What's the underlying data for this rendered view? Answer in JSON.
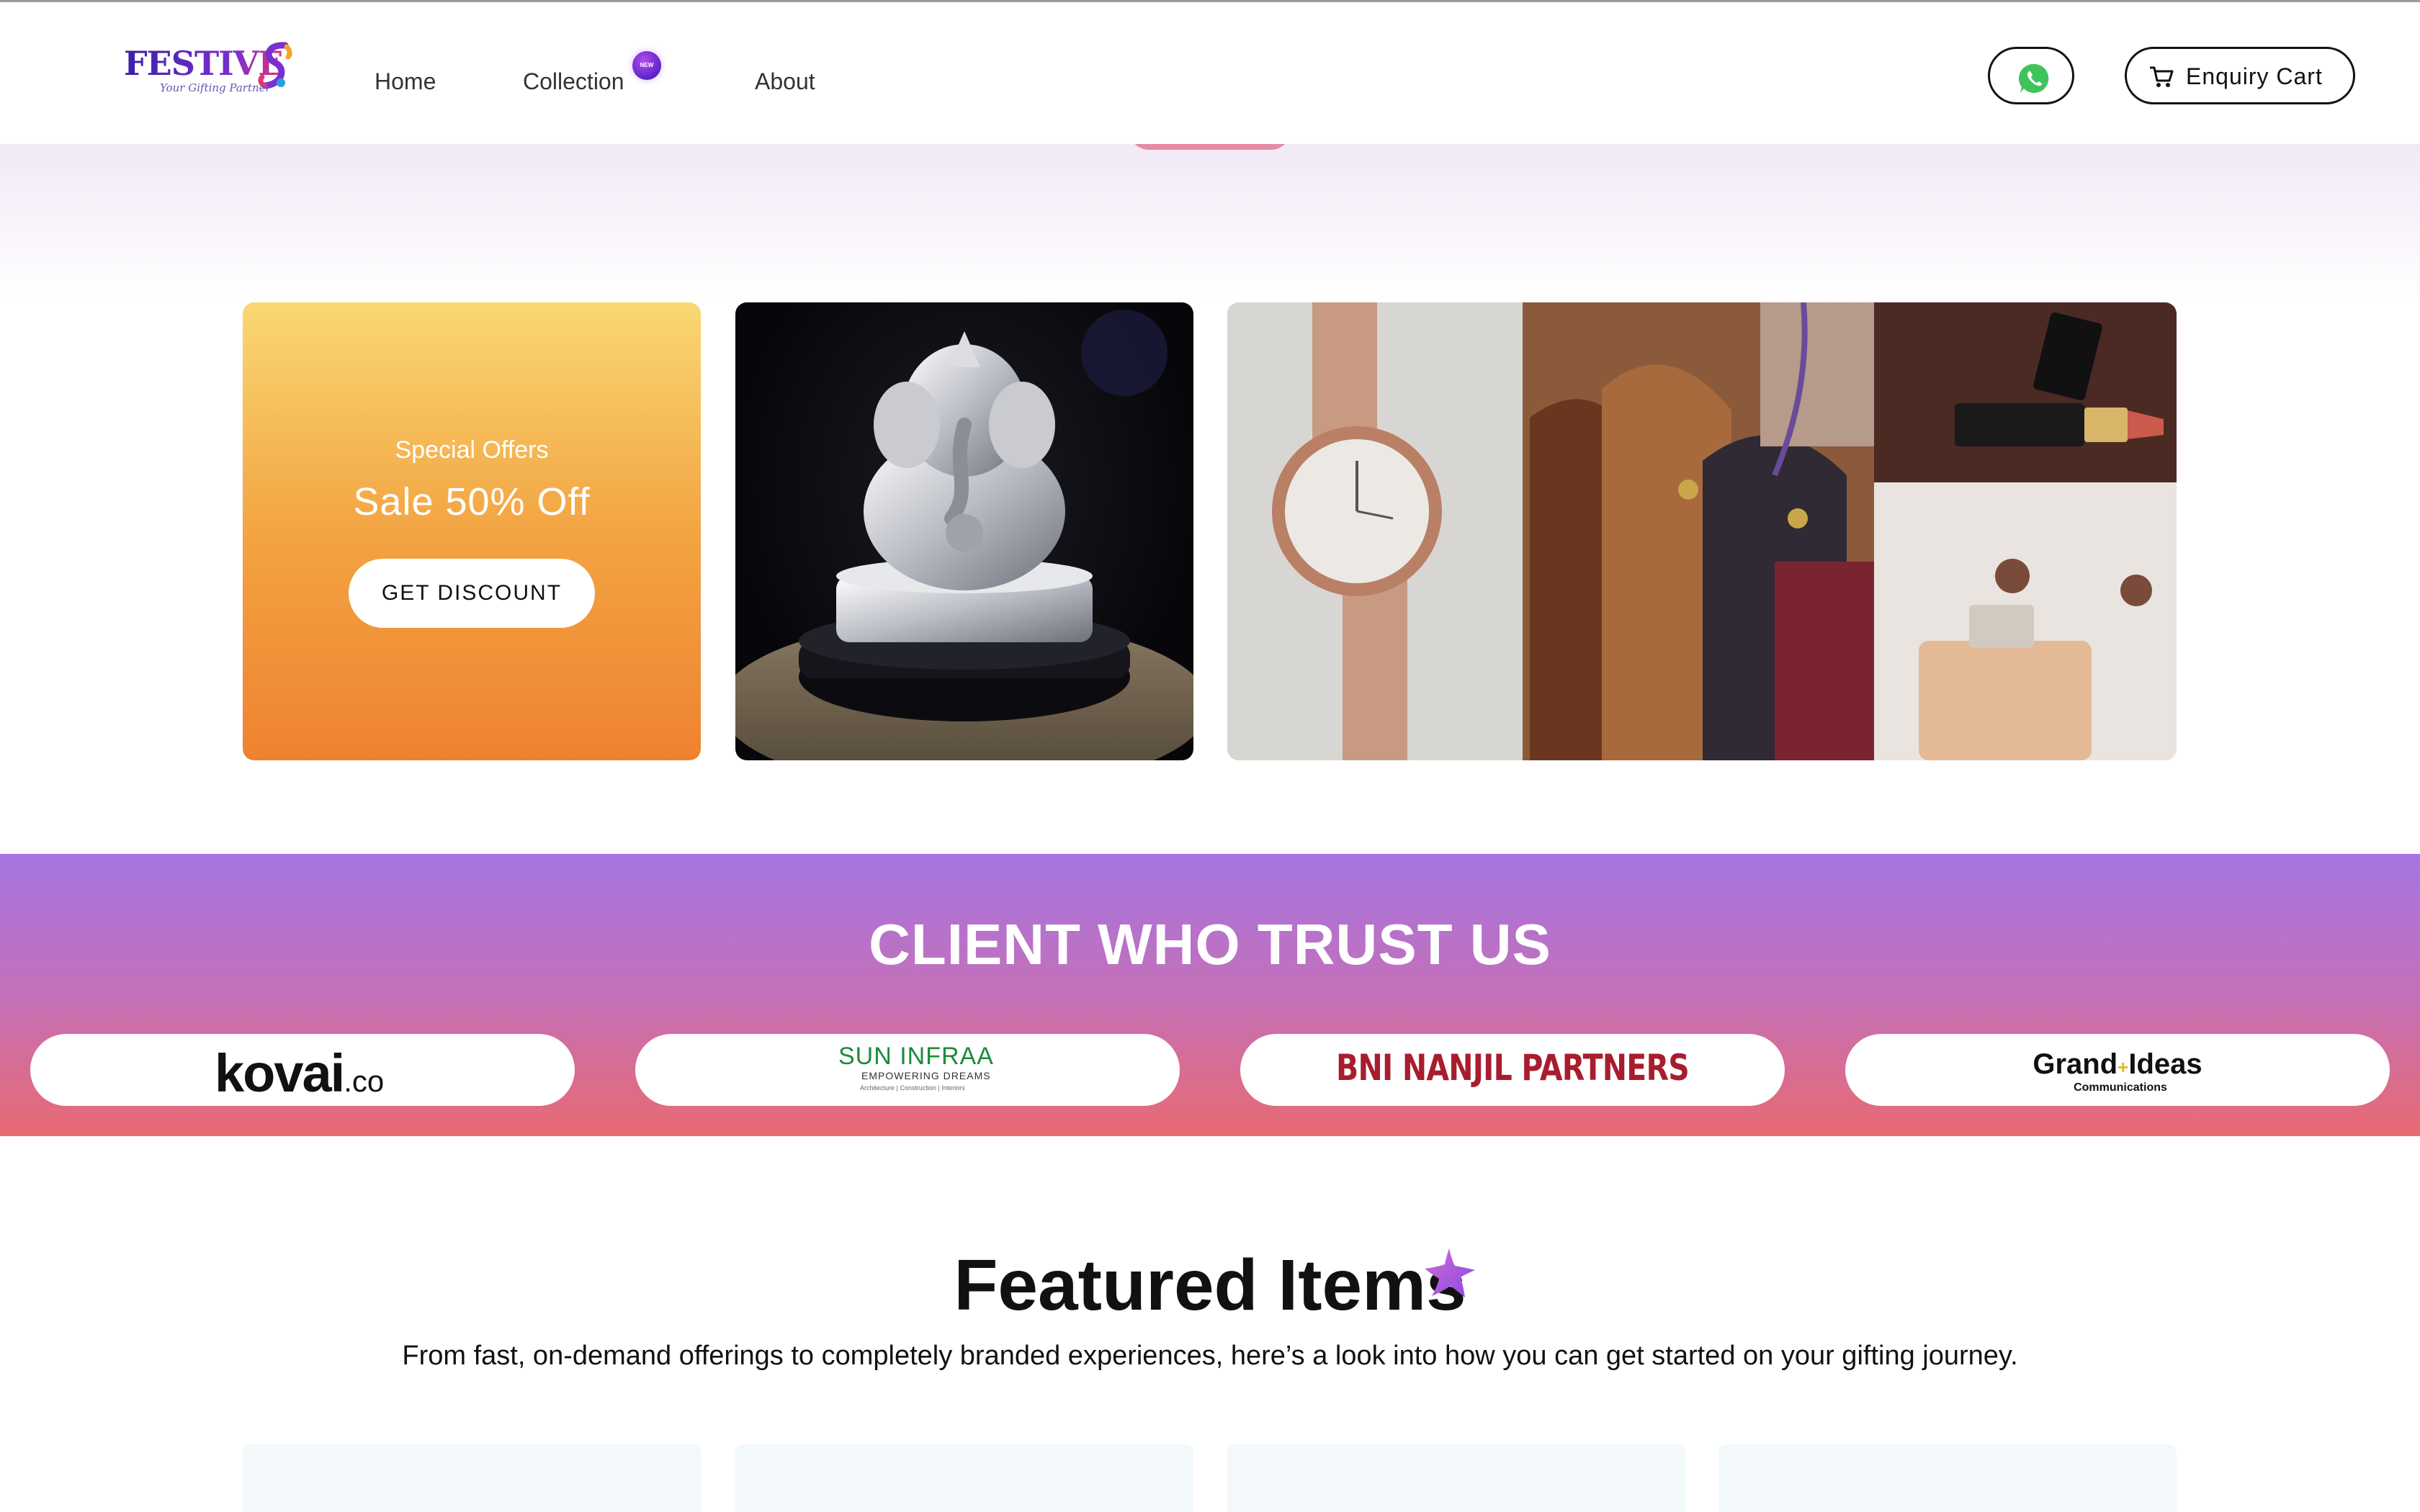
{
  "brand": {
    "name": "FESTIVE",
    "tagline": "Your Gifting Partner"
  },
  "nav": {
    "home": "Home",
    "collection": "Collection",
    "collection_badge": "NEW",
    "about": "About"
  },
  "header_actions": {
    "whatsapp_icon": "whatsapp-icon",
    "cart_icon": "cart-icon",
    "cart_label": "Enquiry Cart"
  },
  "promo": {
    "kicker": "Special Offers",
    "title": "Sale 50% Off",
    "button": "GET DISCOUNT"
  },
  "clients": {
    "title": "CLIENT WHO TRUST US",
    "logos": [
      {
        "name": "kovai",
        "suffix": ".co"
      },
      {
        "name": "SUN INFRAA",
        "sub": "EMPOWERING DREAMS",
        "tiny": "Architecture | Construction | Interiors"
      },
      {
        "name": "BNI NANJIL PARTNERS"
      },
      {
        "name_left": "Grand",
        "name_right": "Ideas",
        "sub": "Communications"
      }
    ]
  },
  "featured": {
    "title": "Featured Items",
    "subtitle": "From fast, on-demand offerings to completely branded experiences, here’s a look into how you can get started on your gifting journey."
  },
  "colors": {
    "offer_top": "#f9d872",
    "offer_bottom": "#ef8230",
    "clients_top": "#a574e2",
    "clients_bottom": "#e86a72",
    "brand_purple": "#3b1fa8"
  }
}
